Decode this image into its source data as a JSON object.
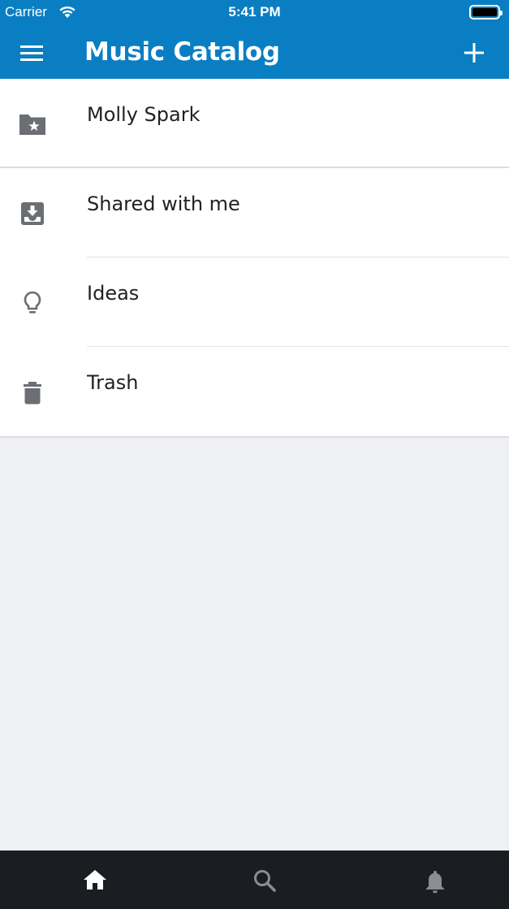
{
  "status_bar": {
    "carrier": "Carrier",
    "time": "5:41 PM",
    "wifi_icon": "wifi-icon",
    "battery_icon": "battery-icon"
  },
  "header": {
    "title": "Music Catalog",
    "menu_icon": "hamburger-menu-icon",
    "add_icon": "plus-icon",
    "background": "#0a7ec2"
  },
  "list": {
    "items": [
      {
        "label": "Molly Spark",
        "icon": "folder-star-icon"
      },
      {
        "label": "Shared with me",
        "icon": "inbox-download-icon"
      },
      {
        "label": "Ideas",
        "icon": "lightbulb-icon"
      },
      {
        "label": "Trash",
        "icon": "trash-icon"
      }
    ]
  },
  "tabbar": {
    "tabs": [
      {
        "name": "home",
        "icon": "home-icon",
        "active": true
      },
      {
        "name": "search",
        "icon": "search-icon",
        "active": false
      },
      {
        "name": "notifications",
        "icon": "bell-icon",
        "active": false
      }
    ],
    "background": "#1a1d21"
  },
  "colors": {
    "accent": "#0a7ec2",
    "icon_gray": "#6b6e72",
    "page_bg": "#eef0f4"
  }
}
